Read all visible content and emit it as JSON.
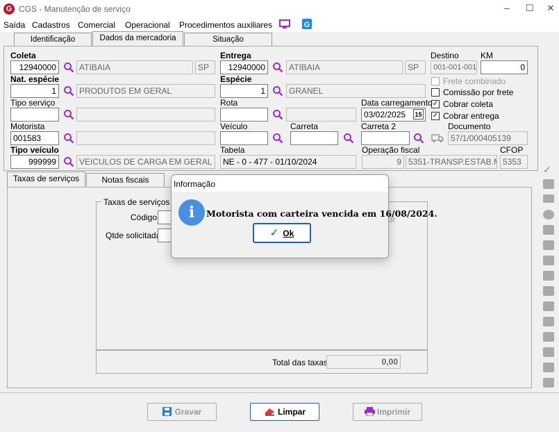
{
  "window": {
    "title": "CGS - Manutenção de serviço",
    "app_icon_letter": "G"
  },
  "menu": {
    "items": [
      "Saída",
      "Cadastros",
      "Comercial",
      "Operacional",
      "Procedimentos auxiliares"
    ]
  },
  "tabs_top": [
    "Identificação",
    "Dados da mercadoria",
    "Situação"
  ],
  "form": {
    "coleta": {
      "label": "Coleta",
      "value": "12940000",
      "city": "ATIBAIA",
      "uf": "SP"
    },
    "entrega": {
      "label": "Entrega",
      "value": "12940000",
      "city": "ATIBAIA",
      "uf": "SP"
    },
    "destino": {
      "label": "Destino",
      "value": "001-001-001"
    },
    "km": {
      "label": "KM",
      "value": "0"
    },
    "nat_especie": {
      "label": "Nat. espécie",
      "value": "1",
      "desc": "PRODUTOS EM GERAL"
    },
    "especie": {
      "label": "Espécie",
      "value": "1",
      "desc": "GRANEL"
    },
    "tipo_servico": {
      "label": "Tipo serviço",
      "value": "",
      "desc": ""
    },
    "rota": {
      "label": "Rota",
      "value": "",
      "desc": ""
    },
    "data_carregamento": {
      "label": "Data carregamento",
      "value": "03/02/2025",
      "cal": "15"
    },
    "motorista": {
      "label": "Motorista",
      "value": "001583",
      "desc": ""
    },
    "veiculo": {
      "label": "Veículo",
      "value": ""
    },
    "carreta": {
      "label": "Carreta",
      "value": ""
    },
    "carreta2": {
      "label": "Carreta 2",
      "value": ""
    },
    "documento": {
      "label": "Documento",
      "value": "57/1/000405139"
    },
    "tipo_veiculo": {
      "label": "Tipo veículo",
      "value": "999999",
      "desc": "VEICULOS DE CARGA EM GERAL"
    },
    "tabela": {
      "label": "Tabela",
      "value": "NE - 0 - 477 - 01/10/2024"
    },
    "operacao_fiscal": {
      "label": "Operação fiscal",
      "value": "9",
      "desc": "5351-TRANSP.ESTAB.ME"
    },
    "cfop": {
      "label": "CFOP",
      "value": "5353"
    }
  },
  "checkboxes": [
    {
      "label": "Frete combinado",
      "checked": false,
      "disabled": true
    },
    {
      "label": "Comissão por frete",
      "checked": false,
      "disabled": false
    },
    {
      "label": "Cobrar coleta",
      "checked": true,
      "disabled": false
    },
    {
      "label": "Cobrar entrega",
      "checked": true,
      "disabled": false
    }
  ],
  "tabs_lower": [
    "Taxas de serviços",
    "Notas fiscais"
  ],
  "taxas": {
    "group_title": "Taxas de serviços (",
    "codigo_label": "Código",
    "qtde_label": "Qtde solicitada",
    "valor_hint": "lor",
    "total_label": "Total das taxas",
    "total_value": "0,00"
  },
  "dialog": {
    "title": "Informação",
    "icon": "i",
    "message": "Motorista com carteira vencida em 16/08/2024.",
    "ok_label": "Ok"
  },
  "buttons": {
    "gravar": "Gravar",
    "limpar": "Limpar",
    "imprimir": "Imprimir"
  },
  "colors": {
    "accent": "#9b30c8",
    "brand": "#c8102e",
    "info": "#4a90e2"
  }
}
